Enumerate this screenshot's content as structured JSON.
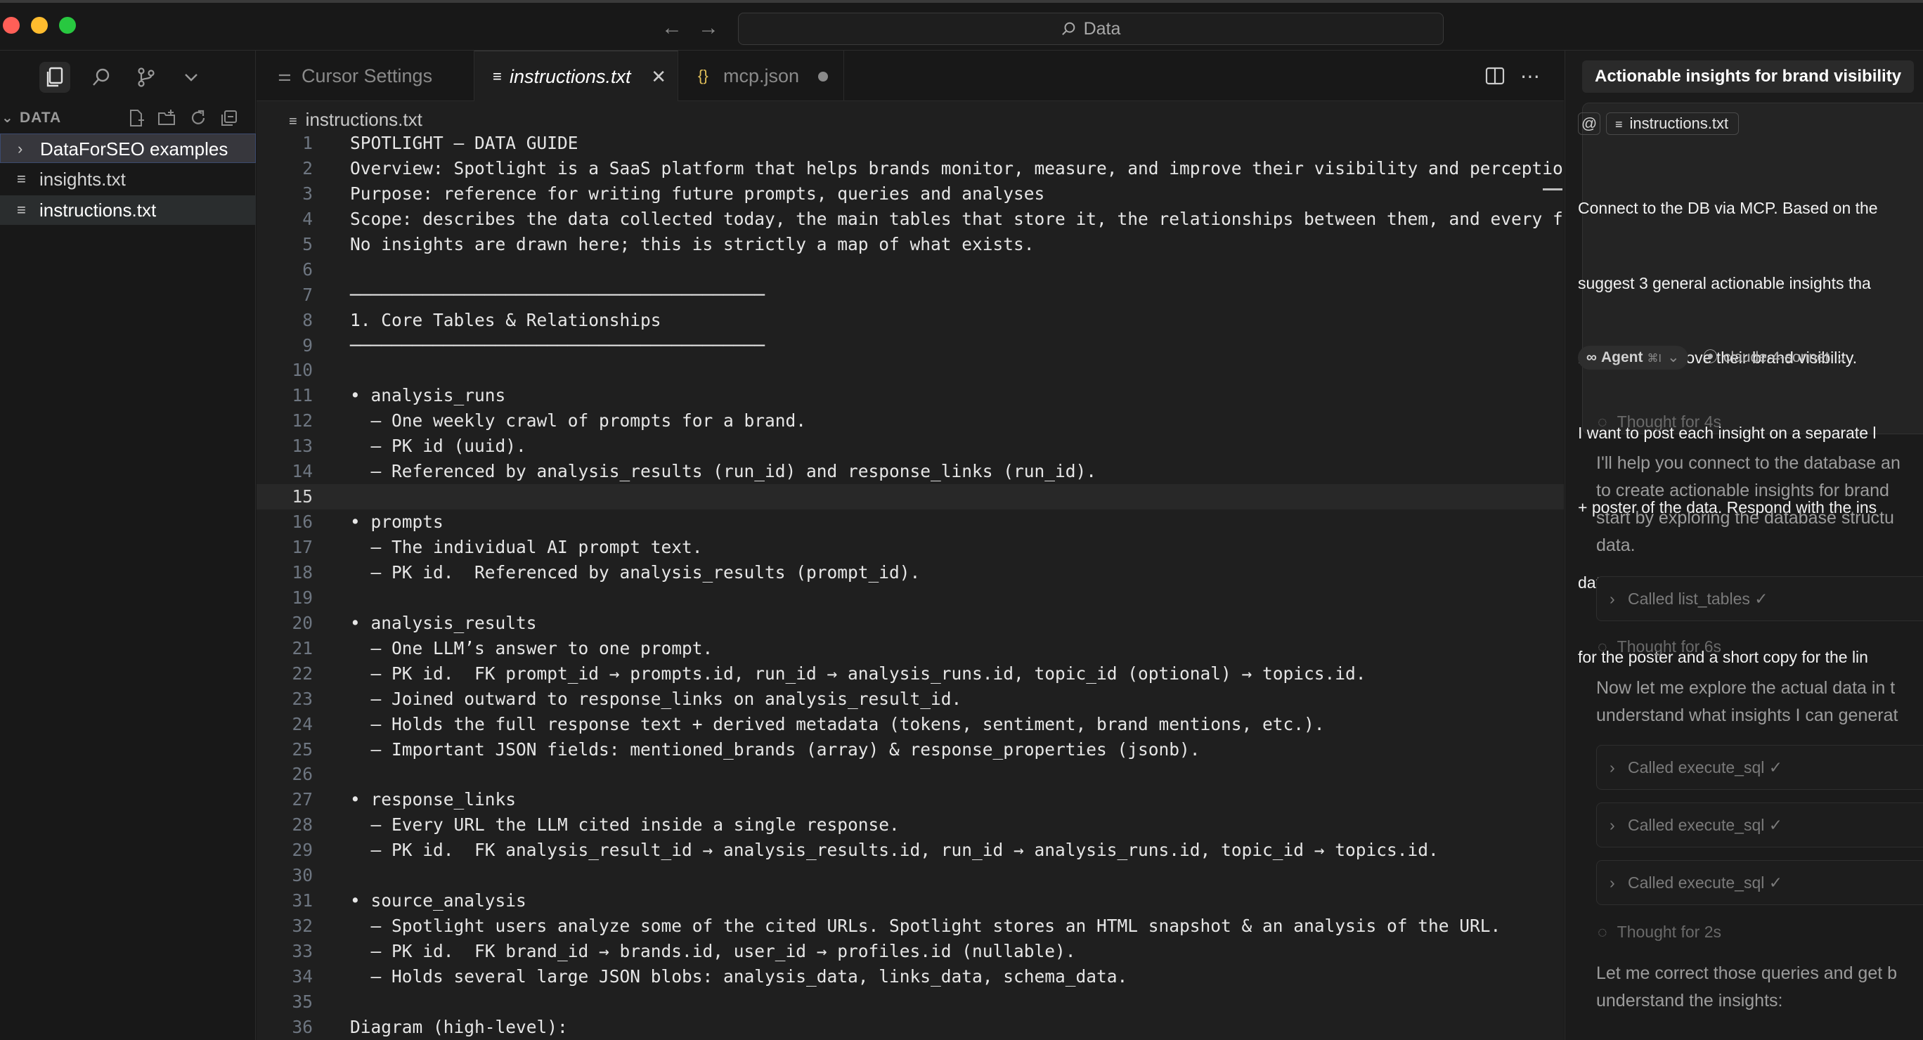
{
  "titlebar": {
    "search_text": "Data"
  },
  "explorer": {
    "section_title": "DATA",
    "items": [
      {
        "label": "DataForSEO examples",
        "kind": "folder"
      },
      {
        "label": "insights.txt",
        "kind": "file"
      },
      {
        "label": "instructions.txt",
        "kind": "file"
      }
    ]
  },
  "tabs": [
    {
      "label": "Cursor Settings",
      "icon": "settings-sliders-icon"
    },
    {
      "label": "instructions.txt",
      "icon": "text-file-icon",
      "active": true
    },
    {
      "label": "mcp.json",
      "icon": "json-braces-icon",
      "modified": true
    }
  ],
  "editor": {
    "breadcrumb": "instructions.txt",
    "current_line": 15,
    "lines": [
      "SPOTLIGHT – DATA GUIDE",
      "Overview: Spotlight is a SaaS platform that helps brands monitor, measure, and improve their visibility and perception w",
      "Purpose: reference for writing future prompts, queries and analyses",
      "Scope: describes the data collected today, the main tables that store it, the relationships between them, and every fiel",
      "No insights are drawn here; this is strictly a map of what exists.",
      "",
      "────────────────────────────────────────",
      "1. Core Tables & Relationships",
      "────────────────────────────────────────",
      "",
      "• analysis_runs",
      "  – One weekly crawl of prompts for a brand.",
      "  – PK id (uuid).",
      "  – Referenced by analysis_results (run_id) and response_links (run_id).",
      "",
      "• prompts",
      "  – The individual AI prompt text.",
      "  – PK id.  Referenced by analysis_results (prompt_id).",
      "",
      "• analysis_results",
      "  – One LLM’s answer to one prompt.",
      "  – PK id.  FK prompt_id → prompts.id, run_id → analysis_runs.id, topic_id (optional) → topics.id.",
      "  – Joined outward to response_links on analysis_result_id.",
      "  – Holds the full response text + derived metadata (tokens, sentiment, brand mentions, etc.).",
      "  – Important JSON fields: mentioned_brands (array) & response_properties (jsonb).",
      "",
      "• response_links",
      "  – Every URL the LLM cited inside a single response.",
      "  – PK id.  FK analysis_result_id → analysis_results.id, run_id → analysis_runs.id, topic_id → topics.id.",
      "",
      "• source_analysis",
      "  – Spotlight users analyze some of the cited URLs. Spotlight stores an HTML snapshot & an analysis of the URL.",
      "  – PK id.  FK brand_id → brands.id, user_id → profiles.id (nullable).",
      "  – Holds several large JSON blobs: analysis_data, links_data, schema_data.",
      "",
      "Diagram (high-level):"
    ]
  },
  "chat": {
    "title": "Actionable insights for brand visibility",
    "context_chip": "instructions.txt",
    "prompt_lines": [
      "Connect to the DB via MCP. Based on the",
      "suggest 3 general actionable insights tha",
      "marketers improve their brand visibility.",
      "I want to post each insight on a separate l",
      "+ poster of the data. Respond with the ins",
      "data, suggested visualization (graph, cha",
      "for the poster and a short copy for the lin"
    ],
    "mode_label": "Agent",
    "mode_shortcut": "⌘I",
    "model_label": "claude-4-sonnet",
    "thoughts": [
      "Thought for 4s",
      "Thought for 6s",
      "Thought for 2s"
    ],
    "message_1": "I'll help you connect to the database an\nto create actionable insights for brand\nstart by exploring the database structu\ndata.",
    "tool_1": "Called list_tables ✓",
    "message_2": "Now let me explore the actual data in t\nunderstand what insights I can generat",
    "tool_2": "Called execute_sql ✓",
    "tool_3": "Called execute_sql ✓",
    "tool_4": "Called execute_sql ✓",
    "message_3": "Let me correct those queries and get b\nunderstand the insights:"
  }
}
